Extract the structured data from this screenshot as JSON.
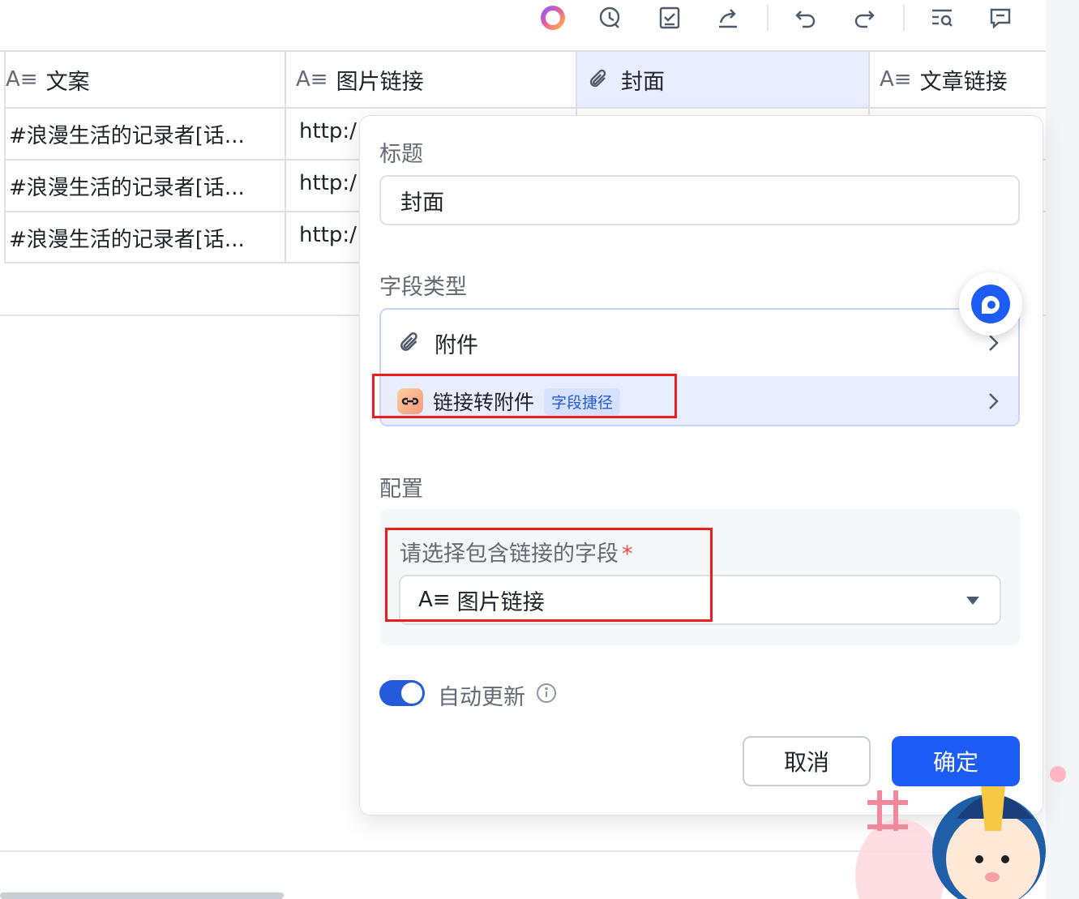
{
  "toolbar": {
    "icons": [
      "ai-assistant-icon",
      "history-icon",
      "task-check-icon",
      "share-icon",
      "undo-icon",
      "redo-icon",
      "search-icon",
      "comment-icon"
    ]
  },
  "grid": {
    "columns": [
      {
        "label": "文案",
        "type_icon": "text-field-icon"
      },
      {
        "label": "图片链接",
        "type_icon": "text-field-icon"
      },
      {
        "label": "封面",
        "type_icon": "attachment-icon"
      },
      {
        "label": "文章链接",
        "type_icon": "text-field-icon"
      }
    ],
    "type_glyph": "A≡",
    "rows": [
      {
        "text": "#浪漫生活的记录者[话...",
        "link": "http:/"
      },
      {
        "text": "#浪漫生活的记录者[话...",
        "link": "http:/"
      },
      {
        "text": "#浪漫生活的记录者[话...",
        "link": "http:/"
      }
    ]
  },
  "dialog": {
    "title_label": "标题",
    "title_value": "封面",
    "field_type_label": "字段类型",
    "field_type": {
      "main_option": "附件",
      "shortcut_option": "链接转附件",
      "shortcut_badge": "字段捷径"
    },
    "config_label": "配置",
    "config": {
      "select_label": "请选择包含链接的字段",
      "required_mark": "*",
      "select_value": "图片链接",
      "select_type_glyph": "A≡"
    },
    "auto_update_label": "自动更新",
    "auto_update_on": true,
    "cancel_label": "取消",
    "ok_label": "确定"
  },
  "colors": {
    "accent": "#1c5cf4",
    "selected_header": "#e8eeff",
    "highlight_box": "#ee1d1d",
    "badge_bg": "#d6e0ff",
    "badge_text": "#245bdb"
  }
}
